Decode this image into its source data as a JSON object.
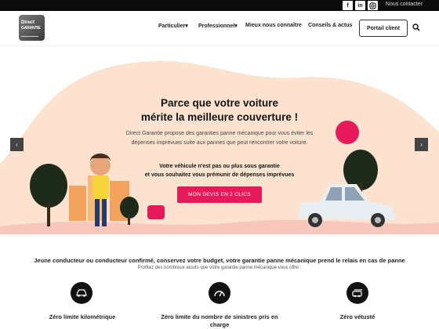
{
  "topbar": {
    "social": [
      "f",
      "in",
      "ig"
    ],
    "contact": "Nous contacter"
  },
  "brand": {
    "line1": "Direct",
    "line2": "GARANTIE"
  },
  "nav": {
    "items": [
      "Particulier",
      "Professionnel",
      "Mieux nous connaître",
      "Conseils & actus"
    ],
    "portal": "Portail client"
  },
  "hero": {
    "title1": "Parce que votre voiture",
    "title2": "mérite la meilleure couverture !",
    "desc1": "Direct Garantie propose des garanties panne mécanique pour vous éviter les",
    "desc2": "dépenses imprévues suite aux pannes que peut rencontrer votre voiture.",
    "sub1": "Votre véhicule n'est pas ou plus sous garantie",
    "sub2": "et vous souhaitez vous prémunir de dépenses imprévues",
    "cta": "MON DEVIS EN 2 CLICS"
  },
  "intro": {
    "title": "Jeune conducteur ou conducteur confirmé, conservez votre budget, votre garantie panne mécanique prend le relais en cas de panne",
    "subtitle": "Profitez des nombreux atouts que votre garantie panne mécanique vous offre :"
  },
  "features": [
    {
      "label1": "Zéro limite kilométrique",
      "label2": "",
      "icon": "car-road-icon"
    },
    {
      "label1": "Zéro limite du nombre de sinistres pris en",
      "label2": "charge",
      "icon": "speedometer-icon"
    },
    {
      "label1": "Zéro vétusté",
      "label2": "",
      "icon": "car-repair-icon"
    }
  ],
  "colors": {
    "accent": "#e6195a",
    "hero_bg": "#fde3cf",
    "dark": "#0b0b0b"
  }
}
